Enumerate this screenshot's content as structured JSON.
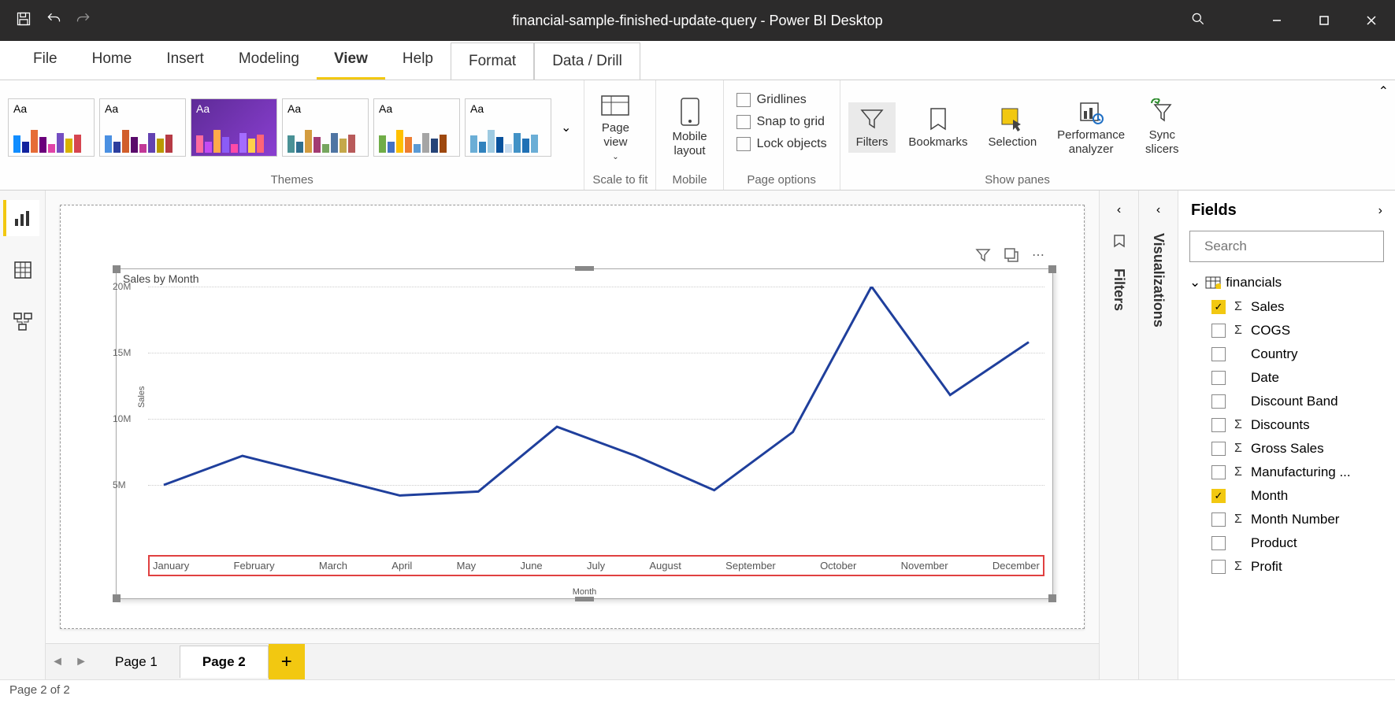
{
  "titlebar": {
    "title": "financial-sample-finished-update-query - Power BI Desktop"
  },
  "menu": {
    "file": "File",
    "home": "Home",
    "insert": "Insert",
    "modeling": "Modeling",
    "view": "View",
    "help": "Help",
    "format": "Format",
    "datadrill": "Data / Drill"
  },
  "ribbon": {
    "themes_label": "Themes",
    "scale_label": "Scale to fit",
    "mobile_label": "Mobile",
    "page_options_label": "Page options",
    "show_panes_label": "Show panes",
    "page_view": "Page\nview",
    "mobile_layout": "Mobile\nlayout",
    "gridlines": "Gridlines",
    "snap": "Snap to grid",
    "lock": "Lock objects",
    "filters": "Filters",
    "bookmarks": "Bookmarks",
    "selection": "Selection",
    "performance": "Performance\nanalyzer",
    "sync": "Sync\nslicers",
    "aa": "Aa"
  },
  "chart_data": {
    "type": "line",
    "title": "Sales by Month",
    "xlabel": "Month",
    "ylabel": "Sales",
    "ylim": [
      0,
      20000000
    ],
    "yticks": [
      "5M",
      "10M",
      "15M",
      "20M"
    ],
    "categories": [
      "January",
      "February",
      "March",
      "April",
      "May",
      "June",
      "July",
      "August",
      "September",
      "October",
      "November",
      "December"
    ],
    "values": [
      5000000,
      7200000,
      5700000,
      4200000,
      4500000,
      9400000,
      7200000,
      4600000,
      9000000,
      20000000,
      11800000,
      15800000
    ]
  },
  "pages": {
    "p1": "Page 1",
    "p2": "Page 2"
  },
  "status": "Page 2 of 2",
  "panes": {
    "filters": "Filters",
    "visualizations": "Visualizations"
  },
  "fields": {
    "title": "Fields",
    "search_placeholder": "Search",
    "table": "financials",
    "items": [
      {
        "label": "Sales",
        "checked": true,
        "sigma": true
      },
      {
        "label": "COGS",
        "checked": false,
        "sigma": true
      },
      {
        "label": "Country",
        "checked": false,
        "sigma": false
      },
      {
        "label": "Date",
        "checked": false,
        "sigma": false
      },
      {
        "label": "Discount Band",
        "checked": false,
        "sigma": false
      },
      {
        "label": "Discounts",
        "checked": false,
        "sigma": true
      },
      {
        "label": "Gross Sales",
        "checked": false,
        "sigma": true
      },
      {
        "label": "Manufacturing ...",
        "checked": false,
        "sigma": true
      },
      {
        "label": "Month",
        "checked": true,
        "sigma": false
      },
      {
        "label": "Month Number",
        "checked": false,
        "sigma": true
      },
      {
        "label": "Product",
        "checked": false,
        "sigma": false
      },
      {
        "label": "Profit",
        "checked": false,
        "sigma": true
      }
    ]
  }
}
